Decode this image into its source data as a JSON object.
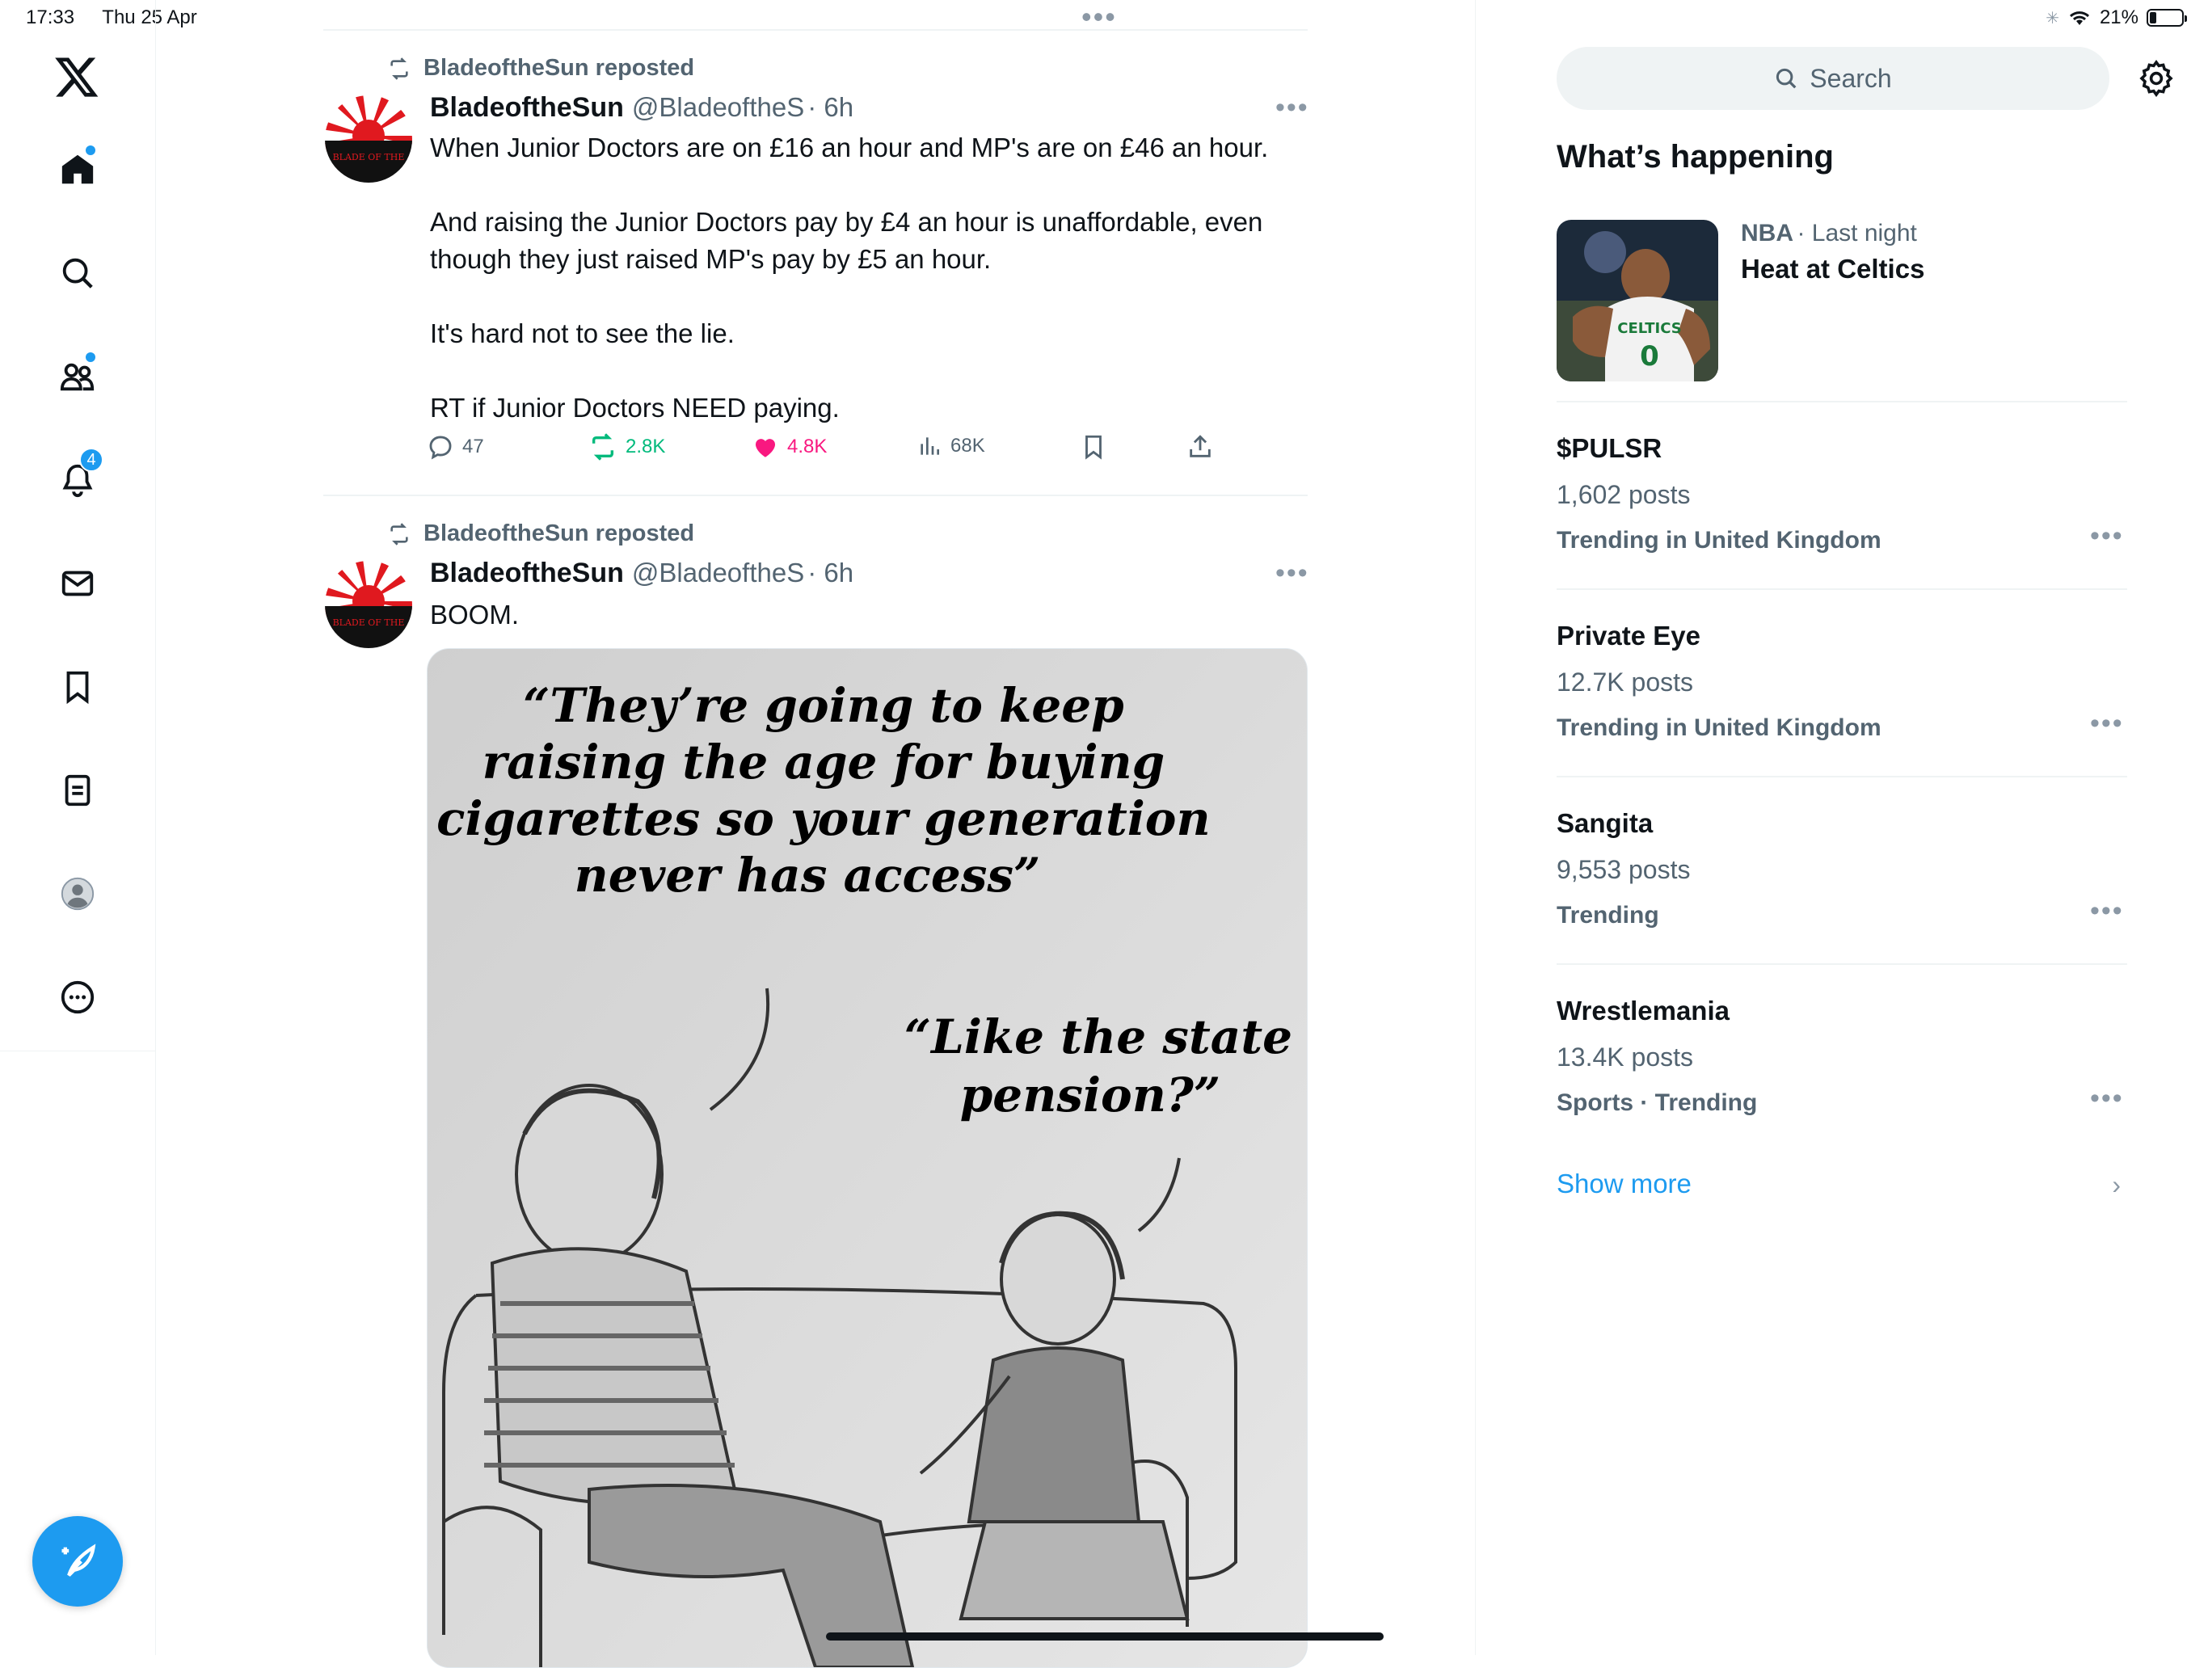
{
  "status_bar": {
    "time": "17:33",
    "date": "Thu 25 Apr",
    "battery": "21%",
    "battery_level": 0.21
  },
  "sidebar": {
    "items": [
      {
        "name": "home-icon"
      },
      {
        "name": "search-icon"
      },
      {
        "name": "communities-icon"
      },
      {
        "name": "notifications-icon",
        "badge": "4"
      },
      {
        "name": "messages-icon"
      },
      {
        "name": "bookmarks-icon"
      },
      {
        "name": "lists-icon"
      },
      {
        "name": "profile-icon"
      },
      {
        "name": "more-icon"
      }
    ]
  },
  "feed": {
    "tweets": [
      {
        "repost_label": "BladeoftheSun reposted",
        "name": "BladeoftheSun",
        "handle": "@BladeoftheS",
        "time": "· 6h",
        "text": "When Junior Doctors are on £16 an hour and MP's are on £46 an hour.\n\nAnd raising the Junior Doctors pay by £4 an hour is unaffordable, even though they just raised MP's pay by £5 an hour.\n\nIt's hard not to see the lie.\n\nRT if Junior Doctors NEED paying.",
        "replies": "47",
        "reposts": "2.8K",
        "likes": "4.8K",
        "views": "68K"
      },
      {
        "repost_label": "BladeoftheSun reposted",
        "name": "BladeoftheSun",
        "handle": "@BladeoftheS",
        "time": "· 6h",
        "text": "BOOM.",
        "image_caption_1": "“They’re going to keep raising the age for buying cigarettes so your generation never has access”",
        "image_caption_2": "“Like the state pension?”"
      }
    ],
    "avatar_text": "BLADE OF THE"
  },
  "right": {
    "search_placeholder": "Search",
    "section_title": "What’s happening",
    "featured": {
      "category": "NBA",
      "meta": "· Last night",
      "title": "Heat at Celtics",
      "jersey": "CELTICS"
    },
    "trends": [
      {
        "title": "$PULSR",
        "posts": "1,602 posts",
        "sub": "Trending in United Kingdom"
      },
      {
        "title": "Private Eye",
        "posts": "12.7K posts",
        "sub": "Trending in United Kingdom"
      },
      {
        "title": "Sangita",
        "posts": "9,553 posts",
        "sub": "Trending"
      },
      {
        "title": "Wrestlemania",
        "posts": "13.4K posts",
        "sub": "Sports · Trending"
      }
    ],
    "show_more": "Show more"
  },
  "colors": {
    "accent": "#1d9bf0",
    "repost": "#00ba7c",
    "like": "#f91880",
    "muted": "#536471"
  }
}
